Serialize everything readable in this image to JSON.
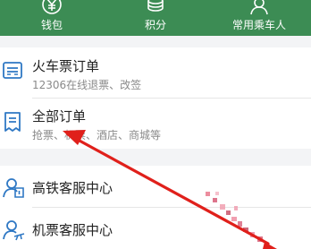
{
  "top_nav": {
    "items": [
      {
        "label": "钱包",
        "icon": "wallet-yen-icon"
      },
      {
        "label": "积分",
        "icon": "coins-icon"
      },
      {
        "label": "常用乘车人",
        "icon": "passenger-icon"
      }
    ]
  },
  "menu": {
    "train_orders": {
      "title": "火车票订单",
      "subtitle": "12306在线退票、改签",
      "icon": "train-ticket-icon"
    },
    "all_orders": {
      "title": "全部订单",
      "subtitle": "抢票、机票、酒店、商城等",
      "icon": "order-list-icon"
    },
    "hsr_service": {
      "title": "高铁客服中心",
      "icon": "hsr-support-icon"
    },
    "flight_service": {
      "title": "机票客服中心",
      "icon": "flight-support-icon"
    }
  },
  "colors": {
    "header_green": "#3c8c54",
    "icon_blue": "#2f78c4",
    "annotation_red": "#e0201b",
    "background": "#f3f4f6"
  }
}
